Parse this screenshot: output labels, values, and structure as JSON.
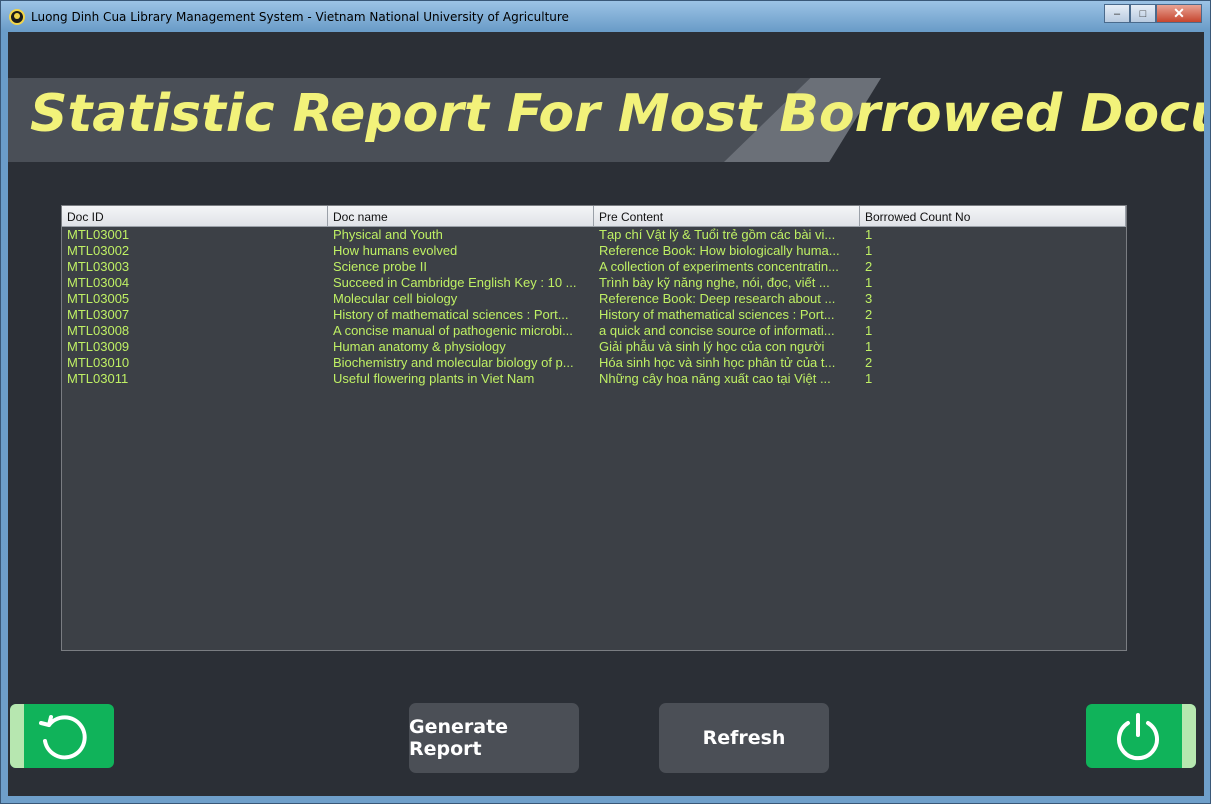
{
  "window": {
    "title": "Luong Dinh Cua Library Management System - Vietnam National University of Agriculture",
    "minimize": "–",
    "maximize": "□",
    "close": "✕"
  },
  "banner": {
    "title": "Statistic Report For Most Borrowed Documents"
  },
  "table": {
    "columns": [
      "Doc ID",
      "Doc name",
      "Pre Content",
      "Borrowed Count No"
    ],
    "rows": [
      [
        "MTL03001",
        "Physical and Youth",
        "Tạp chí Vật lý & Tuổi trẻ gồm các bài vi...",
        "1"
      ],
      [
        "MTL03002",
        "How humans evolved",
        "Reference Book: How biologically huma...",
        "1"
      ],
      [
        "MTL03003",
        "Science probe II",
        "A collection of experiments concentratin...",
        "2"
      ],
      [
        "MTL03004",
        "Succeed in Cambridge English Key : 10 ...",
        "Trình bày kỹ năng nghe, nói, đọc, viết ...",
        "1"
      ],
      [
        "MTL03005",
        "Molecular cell biology",
        "Reference Book: Deep research about ...",
        "3"
      ],
      [
        "MTL03007",
        "History of mathematical sciences : Port...",
        "History of mathematical sciences : Port...",
        "2"
      ],
      [
        "MTL03008",
        "A concise manual of pathogenic microbi...",
        "a quick and concise source of informati...",
        "1"
      ],
      [
        "MTL03009",
        "Human anatomy & physiology",
        "Giải phẫu và sinh lý học của con người",
        "1"
      ],
      [
        "MTL03010",
        "Biochemistry and molecular biology of p...",
        "Hóa sinh học và sinh học phân tử của t...",
        "2"
      ],
      [
        "MTL03011",
        "Useful flowering plants in Viet Nam",
        "Những cây hoa năng xuất cao tại Việt ...",
        "1"
      ]
    ]
  },
  "buttons": {
    "generate": "Generate Report",
    "refresh": "Refresh",
    "back_icon": "undo-icon",
    "exit_icon": "power-icon"
  },
  "colors": {
    "accent": "#10b35a",
    "text_green": "#bff064",
    "title_yellow": "#f2f27a"
  }
}
